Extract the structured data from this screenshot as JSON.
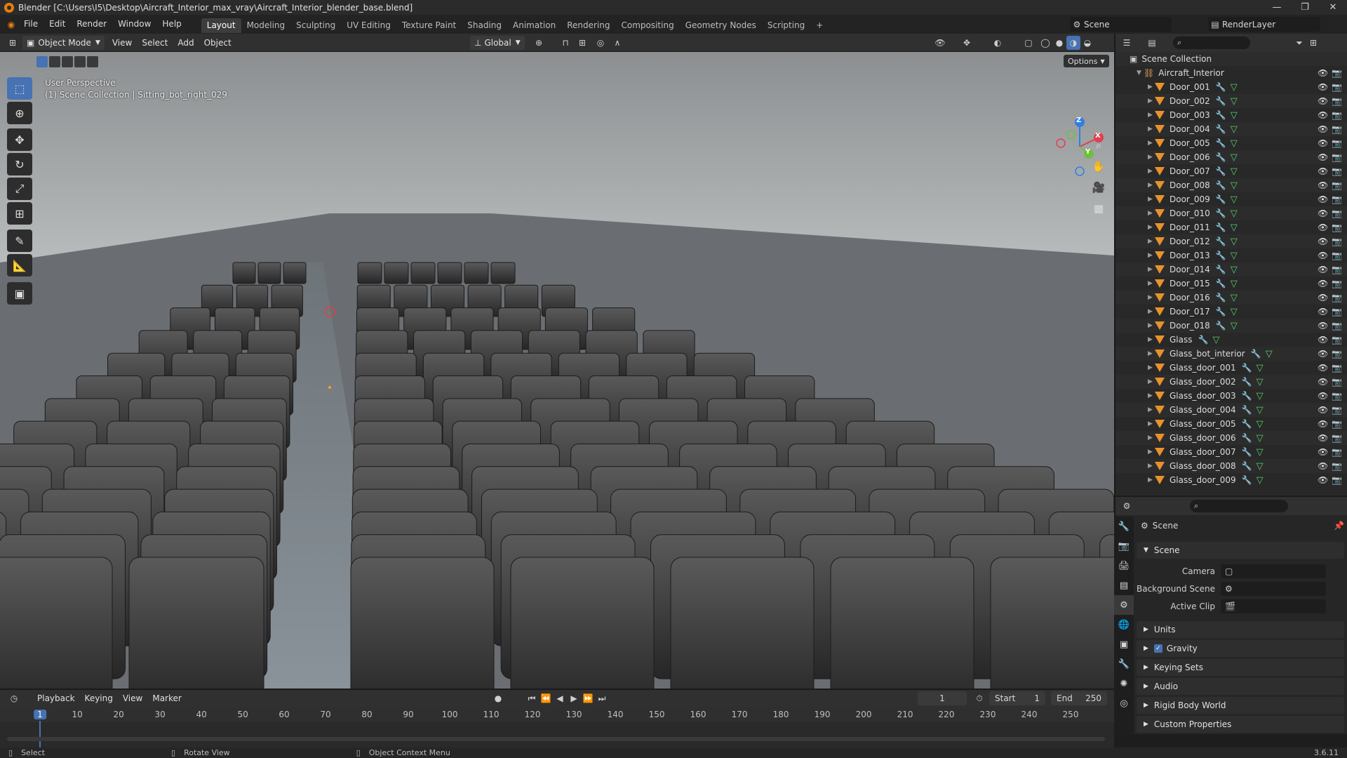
{
  "window": {
    "title": "Blender [C:\\Users\\I5\\Desktop\\Aircraft_Interior_max_vray\\Aircraft_Interior_blender_base.blend]",
    "controls": [
      "—",
      "❐",
      "✕"
    ]
  },
  "menu": [
    "File",
    "Edit",
    "Render",
    "Window",
    "Help"
  ],
  "workspaces": [
    "Layout",
    "Modeling",
    "Sculpting",
    "UV Editing",
    "Texture Paint",
    "Shading",
    "Animation",
    "Rendering",
    "Compositing",
    "Geometry Nodes",
    "Scripting",
    "+"
  ],
  "scene_selector": {
    "scene": "Scene",
    "view_layer": "RenderLayer"
  },
  "viewport_header": {
    "mode": "Object Mode",
    "menus": [
      "View",
      "Select",
      "Add",
      "Object"
    ],
    "orientation": "Global",
    "options": "Options"
  },
  "viewport": {
    "perspective": "User Perspective",
    "collection_info": "(1) Scene Collection | Sitting_bot_right_029"
  },
  "toolbar_icons": [
    "select-box-icon",
    "cursor-icon",
    "move-icon",
    "rotate-icon",
    "scale-icon",
    "transform-icon",
    "annotate-icon",
    "measure-icon",
    "add-cube-icon"
  ],
  "gizmo": {
    "z": "Z",
    "y": "Y",
    "x": "X"
  },
  "outliner": {
    "root": "Scene Collection",
    "collection": "Aircraft_Interior",
    "items": [
      "Door_001",
      "Door_002",
      "Door_003",
      "Door_004",
      "Door_005",
      "Door_006",
      "Door_007",
      "Door_008",
      "Door_009",
      "Door_010",
      "Door_011",
      "Door_012",
      "Door_013",
      "Door_014",
      "Door_015",
      "Door_016",
      "Door_017",
      "Door_018",
      "Glass",
      "Glass_bot_interior",
      "Glass_door_001",
      "Glass_door_002",
      "Glass_door_003",
      "Glass_door_004",
      "Glass_door_005",
      "Glass_door_006",
      "Glass_door_007",
      "Glass_door_008",
      "Glass_door_009"
    ]
  },
  "properties": {
    "context": "Scene",
    "panel": "Scene",
    "fields": [
      {
        "label": "Camera",
        "value": ""
      },
      {
        "label": "Background Scene",
        "value": ""
      },
      {
        "label": "Active Clip",
        "value": ""
      }
    ],
    "sections": [
      "Units",
      "Gravity",
      "Keying Sets",
      "Audio",
      "Rigid Body World",
      "Custom Properties"
    ],
    "gravity_checked": true
  },
  "timeline": {
    "menus": [
      "Playback",
      "Keying",
      "View",
      "Marker"
    ],
    "current_frame": "1",
    "start_label": "Start",
    "start": "1",
    "end_label": "End",
    "end": "250",
    "ticks": [
      "1",
      "10",
      "20",
      "30",
      "40",
      "50",
      "60",
      "70",
      "80",
      "90",
      "100",
      "110",
      "120",
      "130",
      "140",
      "150",
      "160",
      "170",
      "180",
      "190",
      "200",
      "210",
      "220",
      "230",
      "240",
      "250"
    ]
  },
  "statusbar": {
    "left": "Select",
    "middle": "Rotate View",
    "right": "Object Context Menu",
    "version": "3.6.11"
  },
  "colors": {
    "accent": "#4772b3",
    "mesh": "#e8922c",
    "modifier": "#6fa3ff",
    "data": "#53cf6c"
  }
}
